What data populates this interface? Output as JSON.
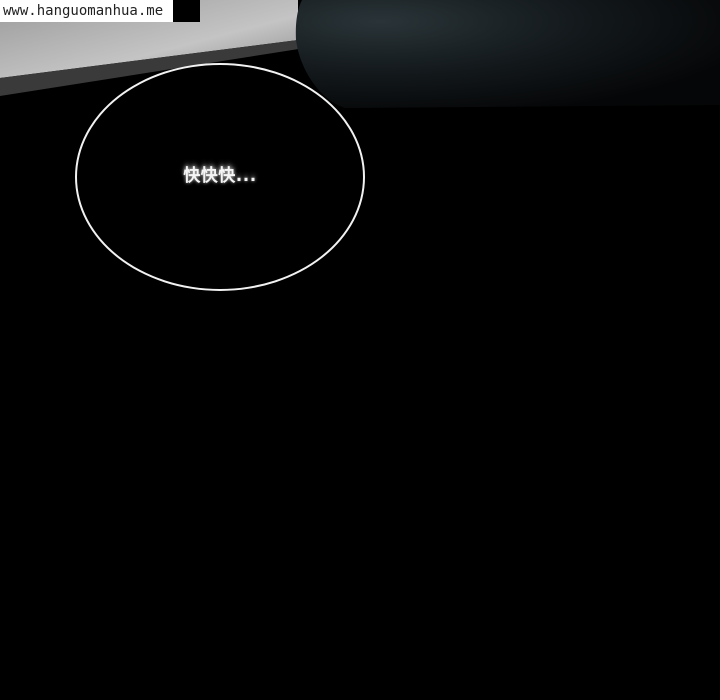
{
  "watermark": {
    "text": "www.hanguomanhua.me"
  },
  "speech_bubble": {
    "text": "快快快..."
  },
  "colors": {
    "background": "#000000",
    "bubble_outline": "#f2f2f2",
    "scene_highlight": "#b9b9b9"
  }
}
